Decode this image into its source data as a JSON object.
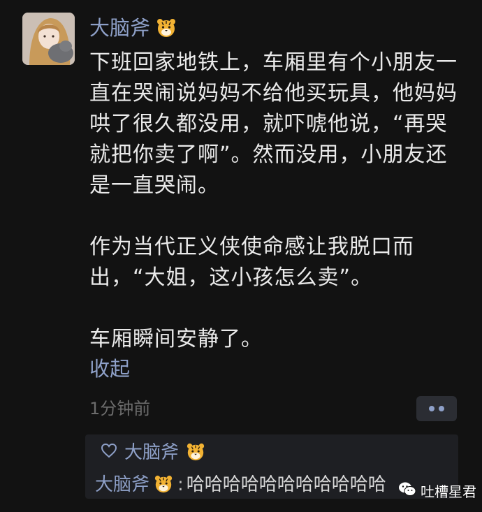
{
  "post": {
    "author": "大脑斧",
    "author_badge_icon": "tiger-face-emoji",
    "paragraphs": [
      "下班回家地铁上，车厢里有个小朋友一直在哭闹说妈妈不给他买玩具，他妈妈哄了很久都没用，就吓唬他说，“再哭就把你卖了啊”。然而没用，小朋友还是一直哭闹。",
      "作为当代正义侠使命感让我脱口而出，“大姐，这小孩怎么卖”。",
      "车厢瞬间安静了。"
    ],
    "collapse_label": "收起",
    "timestamp": "1分钟前"
  },
  "interactions": {
    "likes": {
      "icon": "heart-outline-icon",
      "names": [
        "大脑斧"
      ]
    },
    "replies": [
      {
        "name": "大脑斧",
        "colon": ":",
        "text": "哈哈哈哈哈哈哈哈哈哈哈"
      }
    ]
  },
  "watermark": {
    "label": "吐槽星君",
    "icon": "wechat-icon"
  },
  "colors": {
    "background": "#121212",
    "link": "#8ea0c8",
    "text": "#eaeaea",
    "muted": "#6c6c6c",
    "panel": "#1e1f23"
  }
}
